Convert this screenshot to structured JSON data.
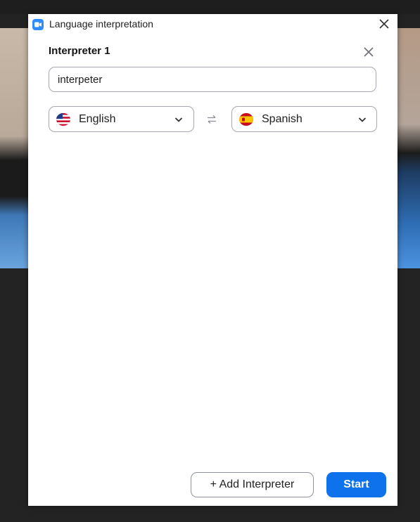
{
  "window": {
    "title": "Language interpretation",
    "app_icon": "zoom-camera-icon",
    "close_icon": "close-icon"
  },
  "interpreter": {
    "heading": "Interpreter 1",
    "name_value": "interpeter",
    "remove_icon": "close-icon"
  },
  "languages": {
    "from": {
      "label": "English",
      "flag_icon": "us-flag-icon"
    },
    "to": {
      "label": "Spanish",
      "flag_icon": "spain-flag-icon"
    },
    "swap_icon": "swap-arrows-icon",
    "dropdown_icon": "chevron-down-icon"
  },
  "actions": {
    "add_label": "+ Add Interpreter",
    "start_label": "Start"
  },
  "colors": {
    "accent": "#0e72ed",
    "app_icon": "#2d8cff",
    "border": "#a6a9b4"
  }
}
